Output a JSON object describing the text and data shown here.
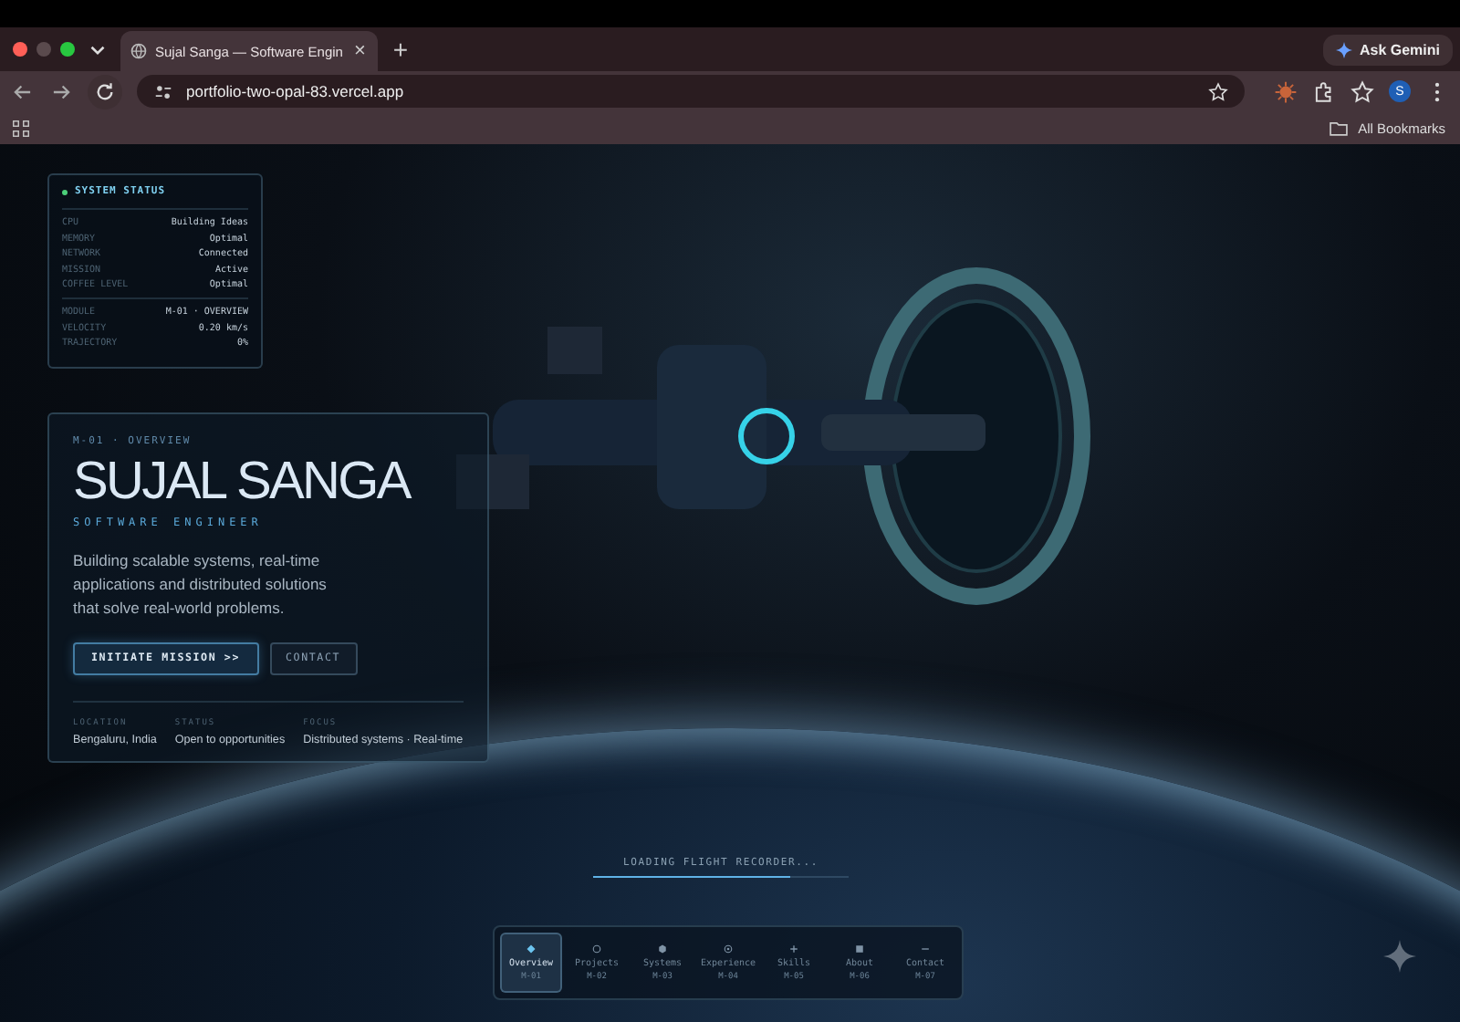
{
  "browser": {
    "tab_title": "Sujal Sanga — Software Engin",
    "tab_close": "×",
    "new_tab": "+",
    "url": "portfolio-two-opal-83.vercel.app",
    "ask_button": "Ask Gemini",
    "profile_initial": "S",
    "bookmarks_label": "All Bookmarks"
  },
  "system_status": {
    "title": "SYSTEM STATUS",
    "groups": [
      [
        {
          "label": "CPU",
          "value": "Building Ideas"
        },
        {
          "label": "MEMORY",
          "value": "Optimal"
        },
        {
          "label": "NETWORK",
          "value": "Connected"
        },
        {
          "label": "MISSION",
          "value": "Active"
        },
        {
          "label": "COFFEE LEVEL",
          "value": "Optimal"
        }
      ],
      [
        {
          "label": "MODULE",
          "value": "M-01 · OVERVIEW"
        },
        {
          "label": "VELOCITY",
          "value": "0.20 km/s"
        },
        {
          "label": "TRAJECTORY",
          "value": "0%"
        }
      ]
    ]
  },
  "hero": {
    "eyebrow": "M-01 · OVERVIEW",
    "name": "SUJAL SANGA",
    "role": "SOFTWARE ENGINEER",
    "summary": "Building scalable systems, real-time applications and distributed solutions that solve real-world problems.",
    "buttons": [
      {
        "label": "INITIATE MISSION >>",
        "kind": "primary"
      },
      {
        "label": "CONTACT",
        "kind": "secondary"
      }
    ],
    "facts": [
      {
        "label": "LOCATION",
        "value": "Bengaluru, India"
      },
      {
        "label": "STATUS",
        "value": "Open to opportunities"
      },
      {
        "label": "FOCUS",
        "value": "Distributed systems · Real-time"
      }
    ]
  },
  "loader": {
    "text": "LOADING FLIGHT RECORDER...",
    "level": 0.77
  },
  "nav": [
    {
      "label": "Overview",
      "code": "M-01",
      "kind": "diamond",
      "selected": true
    },
    {
      "label": "Projects",
      "code": "M-02",
      "kind": "ring",
      "selected": false
    },
    {
      "label": "Systems",
      "code": "M-03",
      "kind": "hex",
      "selected": false
    },
    {
      "label": "Experience",
      "code": "M-04",
      "kind": "target",
      "selected": false
    },
    {
      "label": "Skills",
      "code": "M-05",
      "kind": "plus",
      "selected": false
    },
    {
      "label": "About",
      "code": "M-06",
      "kind": "square",
      "selected": false
    },
    {
      "label": "Contact",
      "code": "M-07",
      "kind": "dash",
      "selected": false
    }
  ]
}
